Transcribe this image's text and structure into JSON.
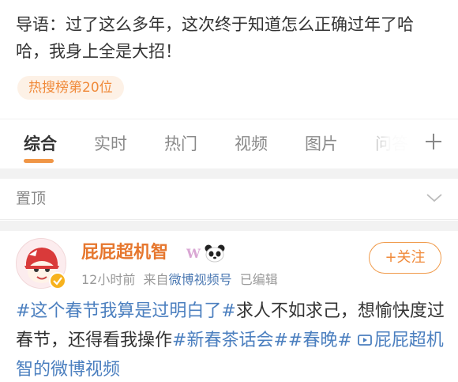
{
  "intro": {
    "text": "导语：过了这么多年，这次终于知道怎么正确过年了哈哈，我身上全是大招！",
    "badge": "热搜榜第20位"
  },
  "tabs": [
    {
      "label": "综合",
      "active": true
    },
    {
      "label": "实时",
      "active": false
    },
    {
      "label": "热门",
      "active": false
    },
    {
      "label": "视频",
      "active": false
    },
    {
      "label": "图片",
      "active": false
    },
    {
      "label": "问答",
      "active": false
    }
  ],
  "pinned": {
    "label": "置顶"
  },
  "post": {
    "username": "屁屁超机智",
    "badge_w": "W",
    "time": "12小时前",
    "source_prefix": "来自",
    "source": "微博视频号",
    "edited": "已编辑",
    "follow_label": "+关注",
    "text": {
      "tag1": "#这个春节我算是过明白了#",
      "body1": "求人不如求己，想愉快度过春节，还得看我操作",
      "tag2": "#新春茶话会#",
      "tag3": "#春晚#",
      "video_link": "屁屁超机智的微博视频"
    }
  },
  "colors": {
    "accent": "#f09646",
    "link": "#4b7fbf",
    "username": "#e6772e",
    "badge_bg": "#fdf1e6"
  },
  "icons": [
    "plus-icon",
    "chevron-down-icon",
    "avatar",
    "verified-badge-icon",
    "panda-icon",
    "video-icon"
  ]
}
